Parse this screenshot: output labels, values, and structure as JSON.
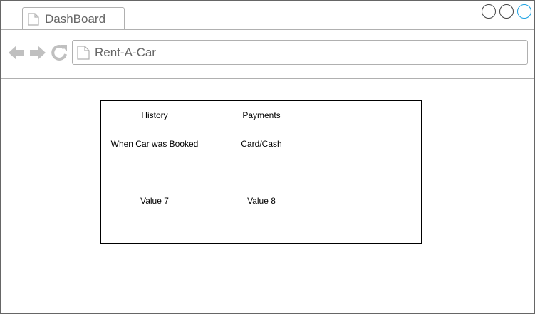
{
  "browser": {
    "tab_title": "DashBoard",
    "url": "Rent-A-Car",
    "accent_color": "#1ba1e2"
  },
  "dashboard": {
    "columns": [
      {
        "header": "History",
        "rows": [
          "When Car was Booked",
          "Value 7"
        ]
      },
      {
        "header": "Payments",
        "rows": [
          "Card/Cash",
          "Value 8"
        ]
      }
    ]
  },
  "icons": {
    "tab": "page-icon",
    "back": "arrow-left-icon",
    "forward": "arrow-right-icon",
    "reload": "reload-icon",
    "url": "page-icon"
  }
}
